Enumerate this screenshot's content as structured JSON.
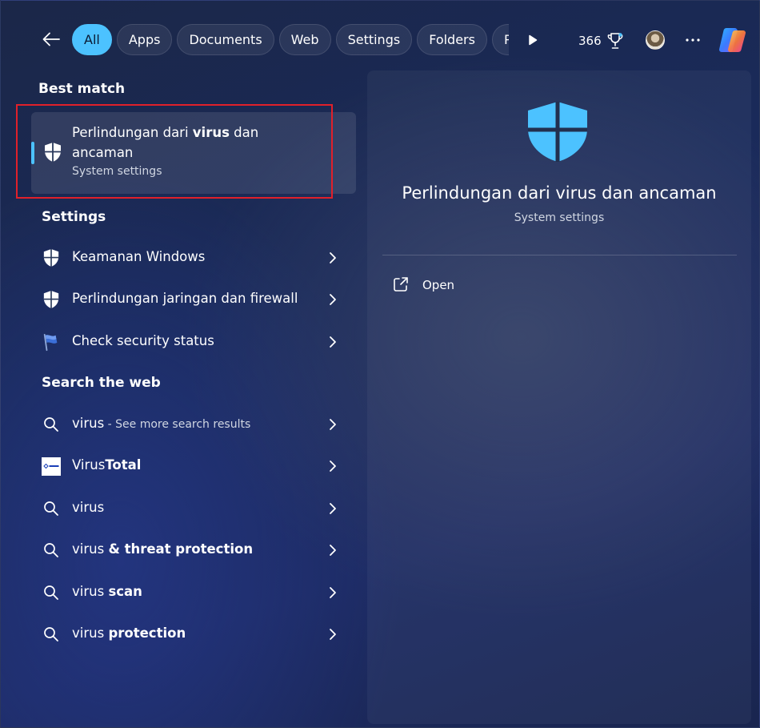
{
  "topbar": {
    "back_icon": "arrow-left-icon",
    "chips": [
      {
        "label": "All",
        "active": true
      },
      {
        "label": "Apps"
      },
      {
        "label": "Documents"
      },
      {
        "label": "Web"
      },
      {
        "label": "Settings"
      },
      {
        "label": "Folders"
      },
      {
        "label": "Photos"
      }
    ],
    "points": "366",
    "points_icon": "trophy-icon",
    "more_icon": "ellipsis-icon",
    "copilot_icon": "copilot-icon"
  },
  "best_match": {
    "heading": "Best match",
    "title_before": "Perlindungan dari ",
    "title_bold": "virus",
    "title_after": " dan ancaman",
    "subtitle": "System settings",
    "icon": "shield-icon"
  },
  "settings": {
    "heading": "Settings",
    "items": [
      {
        "label": "Keamanan Windows",
        "icon": "shield-icon"
      },
      {
        "label": "Perlindungan jaringan dan firewall",
        "icon": "shield-icon"
      },
      {
        "label": "Check security status",
        "icon": "flag-icon"
      }
    ]
  },
  "web": {
    "heading": "Search the web",
    "items": [
      {
        "prefix": "virus",
        "bold": "",
        "muted": " - See more search results",
        "icon": "search-icon"
      },
      {
        "prefix": "Virus",
        "bold": "Total",
        "muted": "",
        "icon": "virustotal-logo-icon"
      },
      {
        "prefix": "virus",
        "bold": "",
        "muted": "",
        "icon": "search-icon"
      },
      {
        "prefix": "virus ",
        "bold": "& threat protection",
        "muted": "",
        "icon": "search-icon"
      },
      {
        "prefix": "virus ",
        "bold": "scan",
        "muted": "",
        "icon": "search-icon"
      },
      {
        "prefix": "virus ",
        "bold": "protection",
        "muted": "",
        "icon": "search-icon"
      }
    ]
  },
  "detail": {
    "title": "Perlindungan dari virus dan ancaman",
    "subtitle": "System settings",
    "open_label": "Open"
  },
  "colors": {
    "accent": "#4cc2ff",
    "highlight": "#e0202a"
  }
}
